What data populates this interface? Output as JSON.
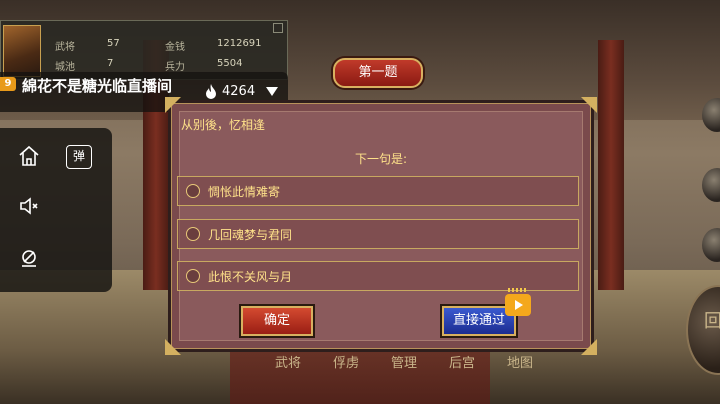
{
  "hero_panel": {
    "stats": [
      {
        "label": "武将",
        "value": "57"
      },
      {
        "label": "金钱",
        "value": "1212691"
      },
      {
        "label": "城池",
        "value": "7"
      },
      {
        "label": "兵力",
        "value": "5504"
      }
    ]
  },
  "live_bar": {
    "level": "9",
    "title": "綿花不是糖光临直播间",
    "popularity": "4264",
    "icons": {
      "fire": "fire-icon",
      "dropdown": "dropdown-arrow-icon"
    }
  },
  "side_tools": {
    "home_icon": "home-icon",
    "danmu_label": "弹",
    "mute_icon": "mute-icon",
    "gyro_icon": "gyroscope-icon"
  },
  "bottom_nav": [
    "武将",
    "俘虏",
    "管理",
    "后宫",
    "地图"
  ],
  "side_button_label": "回",
  "quiz": {
    "title": "第一题",
    "line": "从别後，忆相逢",
    "prompt": "下一句是:",
    "options": [
      "惆怅此情难寄",
      "几回魂梦与君同",
      "此恨不关风与月"
    ],
    "confirm_label": "确定",
    "skip_label": "直接通过"
  },
  "colors": {
    "dialog_bg": "#8a5a5c",
    "text_gold": "#ffe28a",
    "confirm_red": "#c0301e",
    "skip_blue": "#2a3eb0",
    "badge_orange": "#f4a81c"
  }
}
